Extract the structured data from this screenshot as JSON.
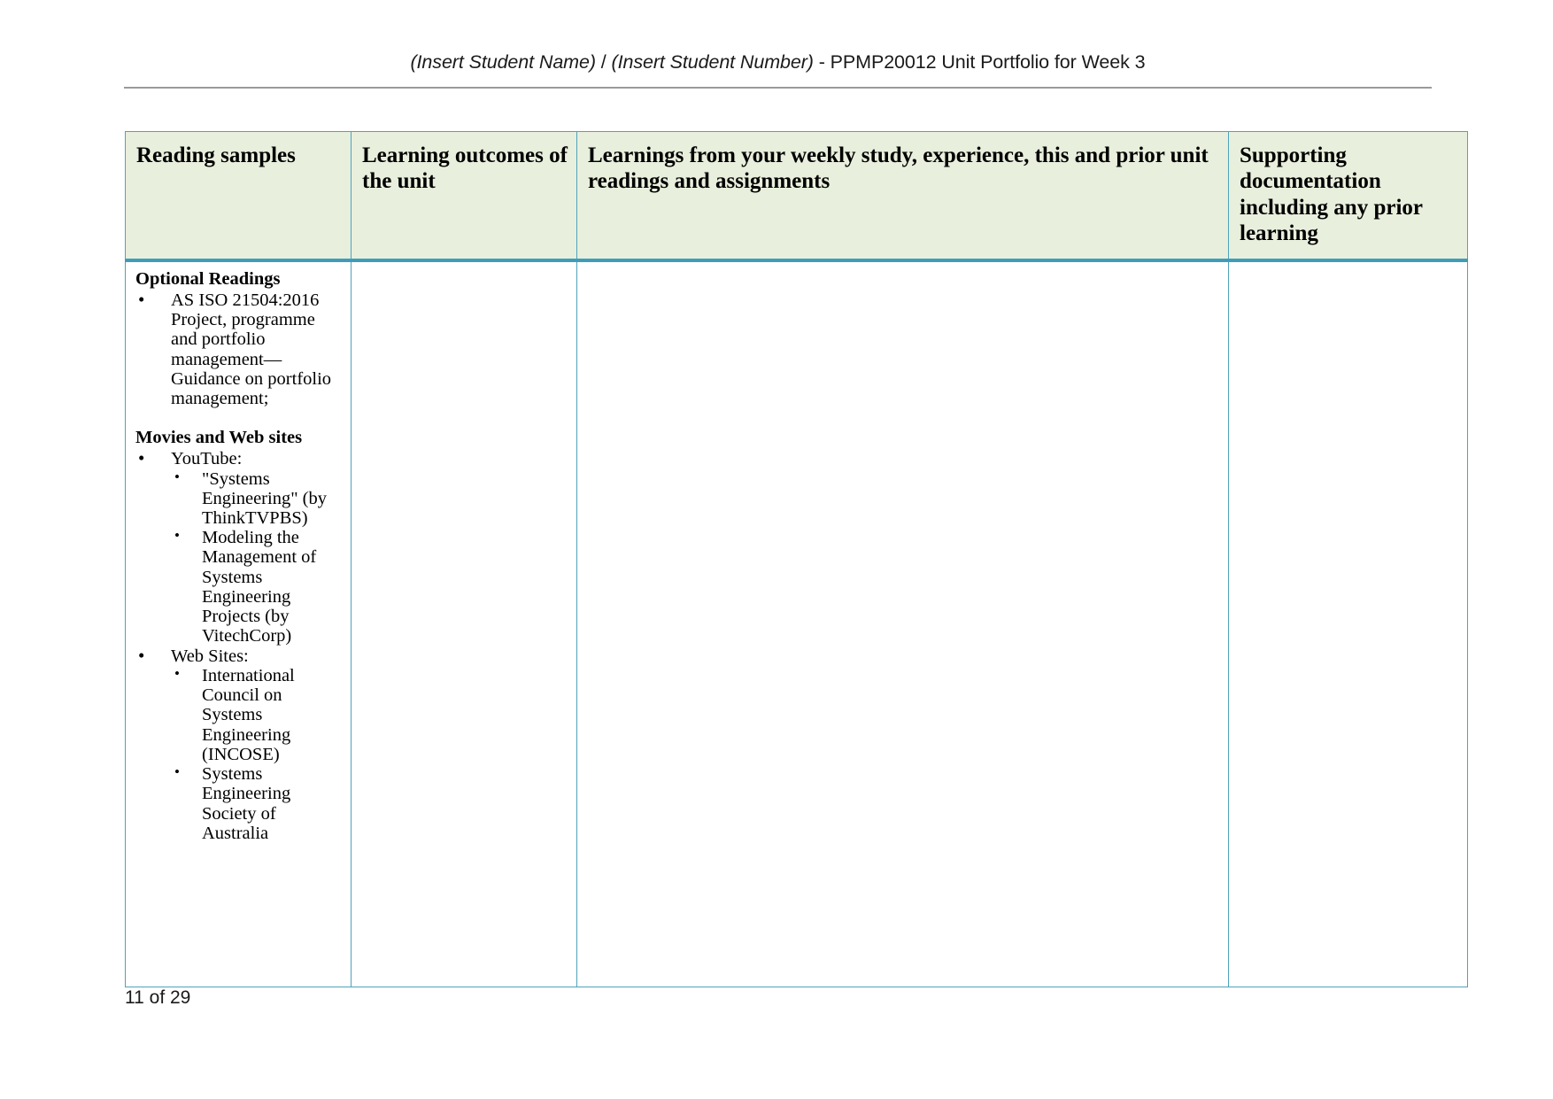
{
  "header": {
    "student_name_placeholder": "(Insert Student Name)",
    "separator": " / ",
    "student_number_placeholder": "(Insert Student Number)",
    "suffix": " - PPMP20012 Unit Portfolio for Week 3",
    "full_text": "(Insert Student Name) / (Insert Student Number) - PPMP20012 Unit Portfolio for Week 3"
  },
  "table": {
    "columns": [
      {
        "label": "Reading samples"
      },
      {
        "label": "Learning outcomes of the unit"
      },
      {
        "label": "Learnings from your weekly study, experience, this and prior unit readings and assignments"
      },
      {
        "label": "Supporting documentation including any prior learning"
      }
    ],
    "row": {
      "reading_samples": {
        "groups": [
          {
            "title": "Optional Readings",
            "items": [
              {
                "text": "AS ISO 21504:2016 Project, programme and portfolio management—Guidance on portfolio management;",
                "children": []
              }
            ]
          },
          {
            "title": "Movies and Web sites",
            "items": [
              {
                "text": "YouTube:",
                "children": [
                  "\"Systems Engineering\" (by ThinkTVPBS)",
                  "Modeling the Management of Systems Engineering Projects (by VitechCorp)"
                ]
              },
              {
                "text": "Web Sites:",
                "children": [
                  "International Council on Systems Engineering (INCOSE)",
                  "Systems Engineering Society of Australia"
                ]
              }
            ]
          }
        ]
      },
      "learning_outcomes": "",
      "learnings_from_study": "",
      "supporting_documentation": ""
    }
  },
  "footer": {
    "page_label": "11 of 29"
  },
  "colors": {
    "table_border": "#4fa3bd",
    "header_fill": "#e8efdc",
    "header_bottom_rule": "#3f9cb8",
    "header_rule": "#9a9a9a",
    "text": "#000000"
  }
}
